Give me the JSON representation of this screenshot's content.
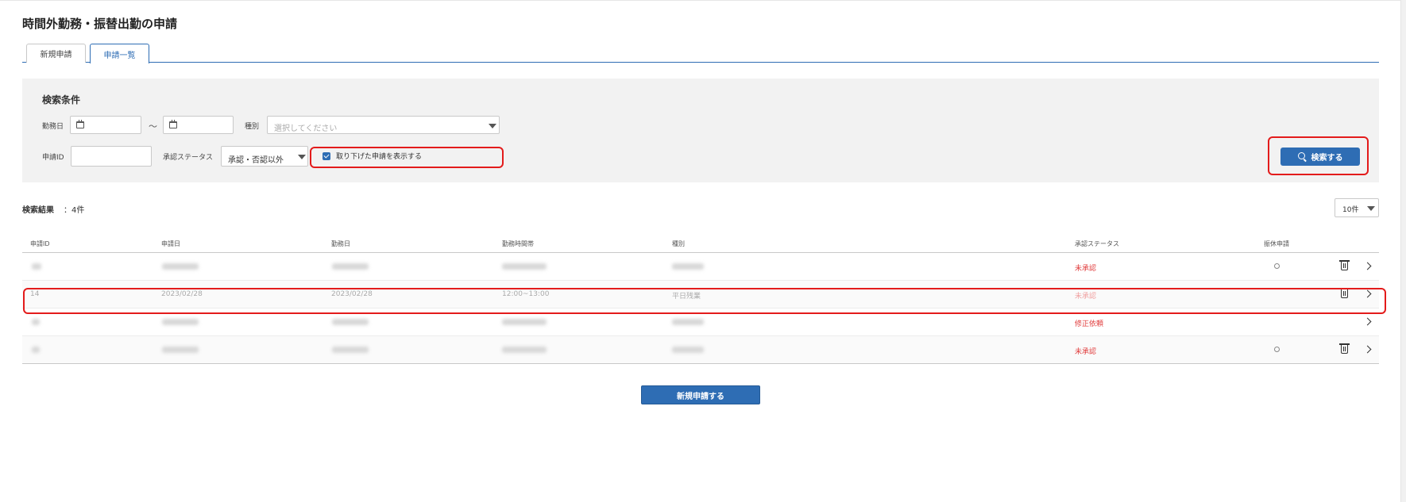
{
  "page": {
    "title": "時間外勤務・振替出勤の申請"
  },
  "tabs": [
    {
      "label": "新規申請",
      "active": false
    },
    {
      "label": "申請一覧",
      "active": true
    }
  ],
  "search": {
    "title": "検索条件",
    "work_date_label": "勤務日",
    "range_separator": "～",
    "type_label": "種別",
    "type_placeholder": "選択してください",
    "apply_id_label": "申請ID",
    "approval_status_label": "承認ステータス",
    "approval_status_value": "承認・否認以外",
    "show_withdrawn_label": "取り下げた申請を表示する",
    "show_withdrawn_checked": true,
    "search_button": "検索する"
  },
  "results": {
    "label": "検索結果",
    "count": "：4件",
    "per_page": "10件"
  },
  "table": {
    "headers": [
      "申請ID",
      "申請日",
      "勤務日",
      "勤務時間帯",
      "種別",
      "承認ステータス",
      "振休申請"
    ],
    "rows": [
      {
        "id": "",
        "apply_date": "",
        "work_date": "",
        "time": "",
        "type": "",
        "status": "未承認",
        "holiday": true,
        "deletable": true,
        "dim": false
      },
      {
        "id": "14",
        "apply_date": "2023/02/28",
        "work_date": "2023/02/28",
        "time": "12:00~13:00",
        "type": "平日残業",
        "status": "未承認",
        "holiday": false,
        "deletable": true,
        "dim": true
      },
      {
        "id": "",
        "apply_date": "",
        "work_date": "",
        "time": "",
        "type": "",
        "status": "修正依頼",
        "holiday": false,
        "deletable": false,
        "dim": false
      },
      {
        "id": "",
        "apply_date": "",
        "work_date": "",
        "time": "",
        "type": "",
        "status": "未承認",
        "holiday": true,
        "deletable": true,
        "dim": false
      }
    ]
  },
  "footer": {
    "new_button": "新規申請する"
  },
  "colors": {
    "primary": "#2e6db4",
    "status_red": "#e03a3a",
    "highlight": "#e31b1b"
  }
}
